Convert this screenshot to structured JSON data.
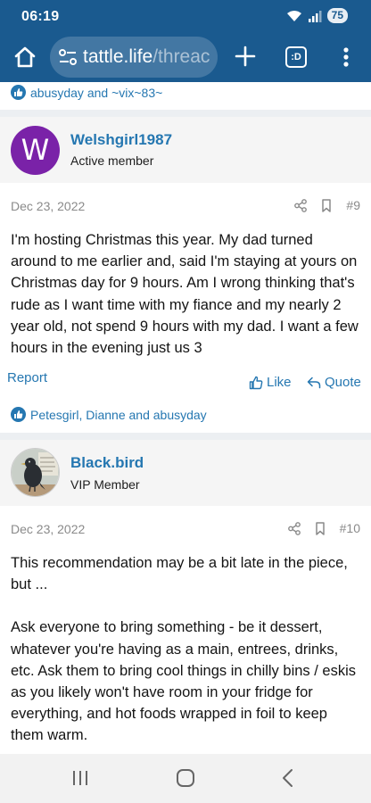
{
  "status_bar": {
    "time": "06:19",
    "battery": "75"
  },
  "browser": {
    "url_host": "tattle.life",
    "url_path": "/threac",
    "tabs_label": ":D"
  },
  "prev_reactions": "abusyday and ~vix~83~",
  "posts": [
    {
      "username": "Welshgirl1987",
      "user_title": "Active member",
      "avatar_letter": "W",
      "avatar_color": "#7a22a8",
      "date": "Dec 23, 2022",
      "number": "#9",
      "paragraphs": [
        "I'm hosting Christmas this year. My dad turned around to me earlier and, said I'm staying at yours on Christmas day for 9 hours. Am I wrong thinking that's rude as I want time with my fiance and my nearly 2 year old, not spend 9 hours with my dad. I want a few hours in the evening just us 3"
      ],
      "report_label": "Report",
      "like_label": "Like",
      "quote_label": "Quote",
      "reactions": "Petesgirl, Dianne and abusyday"
    },
    {
      "username": "Black.bird",
      "user_title": "VIP Member",
      "date": "Dec 23, 2022",
      "number": "#10",
      "paragraphs": [
        "This recommendation may be a bit late in the piece, but ...",
        "Ask everyone to bring something - be it dessert, whatever you're having as a main, entrees, drinks, etc. Ask them to bring cool things in chilly bins / eskis as you likely won't have room in your fridge for everything, and hot foods wrapped in foil to keep them warm."
      ]
    }
  ],
  "colors": {
    "brand": "#1a5a8f",
    "link": "#2577b1",
    "meta": "#8a8a8a"
  }
}
